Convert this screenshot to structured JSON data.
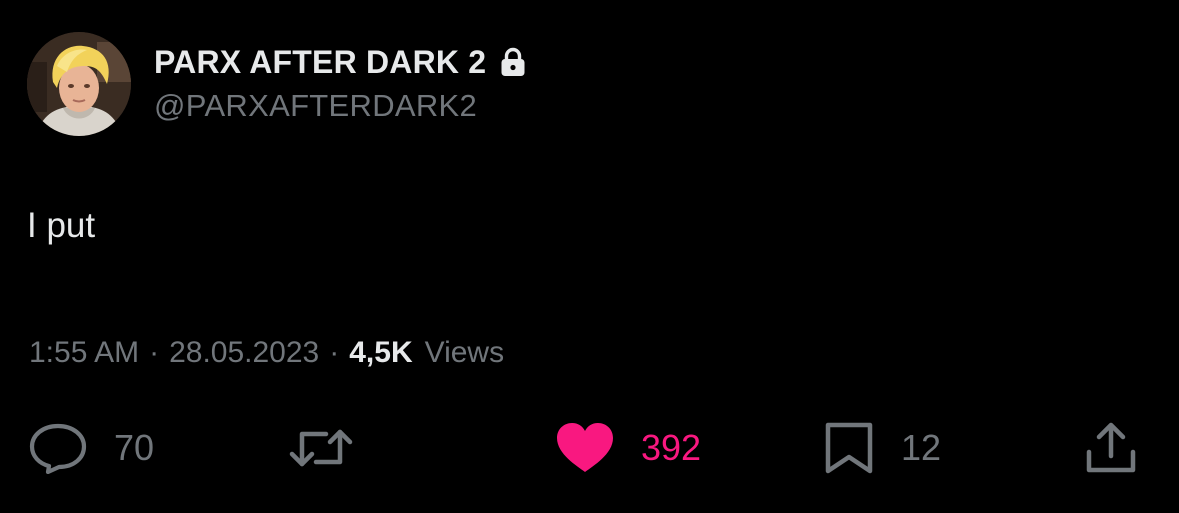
{
  "author": {
    "display_name": "PARX AFTER DARK 2",
    "handle": "@PARXAFTERDARK2",
    "protected": true,
    "avatar_icon": "profile-photo"
  },
  "tweet": {
    "text": "I put"
  },
  "meta": {
    "time": "1:55 AM",
    "separator": "·",
    "date": "28.05.2023",
    "views_count": "4,5K",
    "views_label": "Views"
  },
  "actions": {
    "reply": {
      "icon": "reply-bubble-icon",
      "count": "70"
    },
    "retweet": {
      "icon": "retweet-arrows-icon",
      "count": ""
    },
    "like": {
      "icon": "heart-icon",
      "count": "392",
      "active": true
    },
    "bookmark": {
      "icon": "bookmark-icon",
      "count": "12"
    },
    "share": {
      "icon": "share-icon"
    }
  },
  "colors": {
    "background": "#000000",
    "primary_text": "#e7e9ea",
    "secondary_text": "#71767b",
    "like_active": "#f91880"
  }
}
